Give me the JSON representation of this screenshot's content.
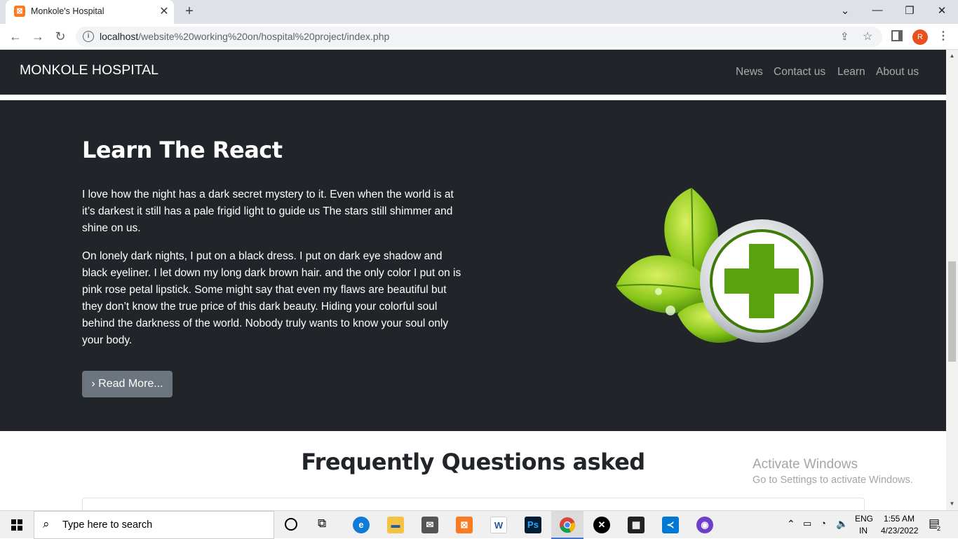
{
  "browser": {
    "tab_title": "Monkole's Hospital",
    "tab_favicon": "xampp-icon",
    "url_host": "localhost",
    "url_path": "/website%20working%20on/hospital%20project/index.php",
    "profile_initial": "R"
  },
  "navbar": {
    "brand": "MONKOLE HOSPITAL",
    "links": [
      "News",
      "Contact us",
      "Learn",
      "About us"
    ]
  },
  "hero": {
    "title": "Learn The React",
    "paragraph1": "I love how the night has a dark secret mystery to it. Even when the world is at it’s darkest it still has a pale frigid light to guide us The stars still shimmer and shine on us.",
    "paragraph2": "On lonely dark nights, I put on a black dress. I put on dark eye shadow and black eyeliner. I let down my long dark brown hair. and the only color I put on is pink rose petal lipstick. Some might say that even my flaws are beautiful but they don’t know the true price of this dark beauty. Hiding your colorful soul behind the darkness of the world. Nobody truly wants to know your soul only your body.",
    "button_label": "Read More...",
    "image": "medical-cross-leaves-logo"
  },
  "faq": {
    "title": "Frequently Questions asked"
  },
  "watermark": {
    "line1": "Activate Windows",
    "line2": "Go to Settings to activate Windows."
  },
  "taskbar": {
    "search_placeholder": "Type here to search",
    "language": "ENG",
    "region": "IN",
    "time": "1:55 AM",
    "date": "4/23/2022",
    "notification_count": "2"
  },
  "colors": {
    "navbar_bg": "#212529",
    "button_bg": "#6c757d",
    "accent_green": "#5aa30e"
  }
}
